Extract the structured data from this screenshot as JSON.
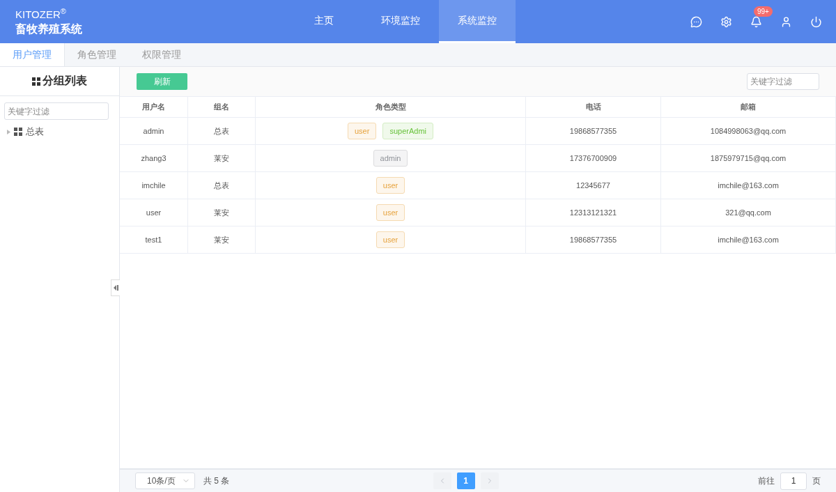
{
  "brand": {
    "name": "KITOZER",
    "mark": "®",
    "subtitle": "畜牧养殖系统"
  },
  "nav": [
    {
      "label": "主页",
      "selected": false
    },
    {
      "label": "环境监控",
      "selected": false
    },
    {
      "label": "系统监控",
      "selected": true
    }
  ],
  "notification_badge": "99+",
  "tabs": [
    {
      "label": "用户管理",
      "selected": true
    },
    {
      "label": "角色管理",
      "selected": false
    },
    {
      "label": "权限管理",
      "selected": false
    }
  ],
  "sidebar": {
    "title": "分组列表",
    "filter_placeholder": "关键字过滤",
    "tree": [
      {
        "label": "总表",
        "expanded": false
      }
    ]
  },
  "toolbar": {
    "refresh": "刷新",
    "filter_placeholder": "关键字过滤"
  },
  "table": {
    "columns": [
      "用户名",
      "组名",
      "角色类型",
      "电话",
      "邮箱"
    ],
    "rows": [
      {
        "username": "admin",
        "group": "总表",
        "roles": [
          {
            "label": "user",
            "kind": "user"
          },
          {
            "label": "superAdmi",
            "kind": "super"
          }
        ],
        "phone": "19868577355",
        "email": "1084998063@qq.com"
      },
      {
        "username": "zhang3",
        "group": "莱安",
        "roles": [
          {
            "label": "admin",
            "kind": "admin"
          }
        ],
        "phone": "17376700909",
        "email": "1875979715@qq.com"
      },
      {
        "username": "imchile",
        "group": "总表",
        "roles": [
          {
            "label": "user",
            "kind": "user"
          }
        ],
        "phone": "12345677",
        "email": "imchile@163.com"
      },
      {
        "username": "user",
        "group": "莱安",
        "roles": [
          {
            "label": "user",
            "kind": "user"
          }
        ],
        "phone": "12313121321",
        "email": "321@qq.com"
      },
      {
        "username": "test1",
        "group": "莱安",
        "roles": [
          {
            "label": "user",
            "kind": "user"
          }
        ],
        "phone": "19868577355",
        "email": "imchile@163.com"
      }
    ]
  },
  "pagination": {
    "page_size": "10条/页",
    "total": "共 5 条",
    "pages": [
      {
        "label": "1",
        "selected": true
      }
    ],
    "goto_label": "前往",
    "goto_value": "1",
    "goto_suffix": "页"
  }
}
